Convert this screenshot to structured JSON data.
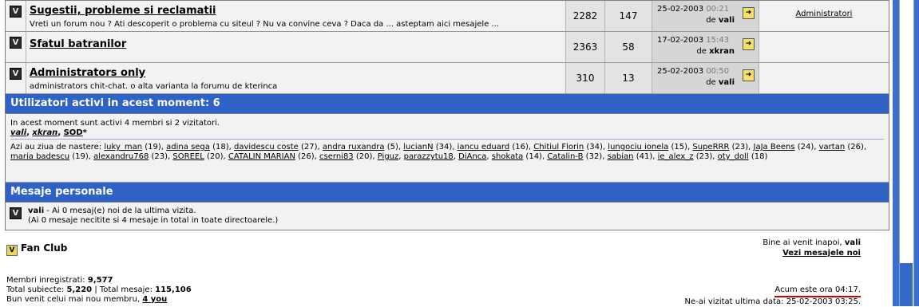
{
  "forums": [
    {
      "title": "Sugestii, probleme si reclamatii",
      "description": "Vreti un forum nou ? Ati descoperit o problema cu siteul ? Nu va convine ceva ? Daca da ... asteptam aici mesajele ...",
      "topics": "2282",
      "posts": "147",
      "last_date": "25-02-2003",
      "last_time": "00:21",
      "last_by_prefix": "de",
      "last_by": "vali",
      "moderator": "Administratori"
    },
    {
      "title": "Sfatul batranilor",
      "description": "",
      "topics": "2363",
      "posts": "58",
      "last_date": "17-02-2003",
      "last_time": "15:43",
      "last_by_prefix": "de",
      "last_by": "xkran",
      "moderator": ""
    },
    {
      "title": "Administrators only",
      "description": "administrators chit-chat. o alta varianta la forumu de kterinca",
      "topics": "310",
      "posts": "13",
      "last_date": "25-02-2003",
      "last_time": "00:50",
      "last_by_prefix": "de",
      "last_by": "vali",
      "moderator": ""
    }
  ],
  "online": {
    "heading": "Utilizatori activi in acest moment: 6",
    "summary": "In acest moment sunt activi 4 membri si 2 vizitatori.",
    "users": [
      "vali",
      "xkran",
      "SOD"
    ],
    "birthday_prefix": "Azi au ziua de nastere:",
    "birthdays": [
      {
        "name": "luky_man",
        "age": "(19)"
      },
      {
        "name": "adina sega",
        "age": "(18)"
      },
      {
        "name": "davidescu coste",
        "age": "(27)"
      },
      {
        "name": "andra ruxandra",
        "age": "(5)"
      },
      {
        "name": "lucianN",
        "age": "(34)"
      },
      {
        "name": "iancu eduard",
        "age": "(16)"
      },
      {
        "name": "Chitiul Florin",
        "age": "(34)"
      },
      {
        "name": "lungociu ionela",
        "age": "(15)"
      },
      {
        "name": "SupeRRR",
        "age": "(23)"
      },
      {
        "name": "JaJa Beens",
        "age": "(24)"
      },
      {
        "name": "vartan",
        "age": "(26)"
      },
      {
        "name": "maria badescu",
        "age": "(19)"
      },
      {
        "name": "alexandru768",
        "age": "(23)"
      },
      {
        "name": "SOREEL",
        "age": "(20)"
      },
      {
        "name": "CATALIN MARIAN",
        "age": "(26)"
      },
      {
        "name": "cserni83",
        "age": "(20)"
      },
      {
        "name": "Piguz",
        "age": ""
      },
      {
        "name": "parazzytu18",
        "age": ""
      },
      {
        "name": "DiAnca",
        "age": ""
      },
      {
        "name": "shokata",
        "age": "(14)"
      },
      {
        "name": "Catalin-B",
        "age": "(32)"
      },
      {
        "name": "sabian",
        "age": "(41)"
      },
      {
        "name": "ie_alex_z",
        "age": "(23)"
      },
      {
        "name": "oty_doll",
        "age": "(18)"
      }
    ]
  },
  "pm": {
    "heading": "Mesaje personale",
    "user": "vali",
    "line1": " - Ai 0 mesaj(e) noi de la ultima vizita.",
    "line2": "(Ai 0 mesaje necitite si 4 mesaje in total in toate directoarele.)"
  },
  "footer": {
    "fan_club": "Fan Club",
    "welcome_text": "Bine ai venit inapoi,",
    "welcome_user": "vali",
    "view_new": "Vezi mesajele noi",
    "members_label": "Membri inregistrati:",
    "members": "9,577",
    "topics_label": "Total subiecte:",
    "topics": "5,220",
    "posts_label": "Total mesaje:",
    "posts": "115,106",
    "newest_label": "Bun venit celui mai nou membru,",
    "newest": "4 you",
    "now_label": "Acum este ora 04:17.",
    "last_visit_label": "Ne-ai vizitat ultima data:",
    "last_visit": "25-02-2003 03:25."
  },
  "colors": {
    "section_header": "#2f62c6",
    "scrollbar": "#3a6fd0",
    "highlight_underline": "#d40000"
  }
}
